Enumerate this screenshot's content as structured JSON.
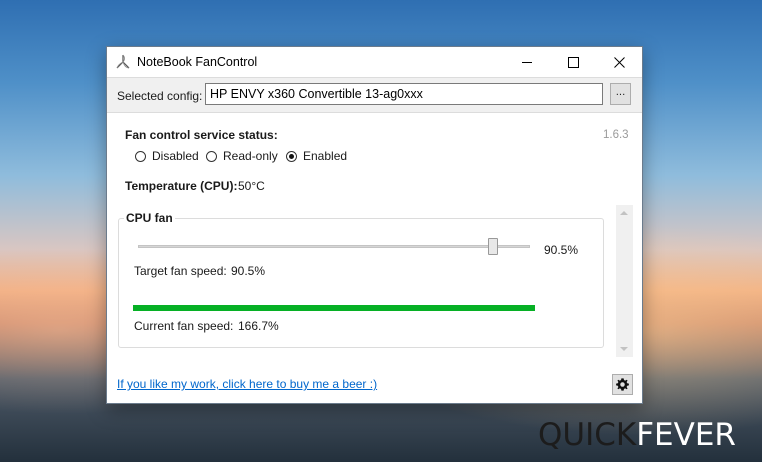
{
  "window": {
    "title": "NoteBook FanControl",
    "icon": "fan-icon",
    "controls": [
      "minimize-icon",
      "maximize-icon",
      "close-icon"
    ]
  },
  "config": {
    "label": "Selected config:",
    "value": "HP ENVY x360 Convertible 13-ag0xxx",
    "browse_label": "..."
  },
  "version": "1.6.3",
  "service": {
    "label": "Fan control service status:",
    "options": [
      {
        "label": "Disabled",
        "checked": false
      },
      {
        "label": "Read-only",
        "checked": false
      },
      {
        "label": "Enabled",
        "checked": true
      }
    ]
  },
  "temperature": {
    "label": "Temperature (CPU):",
    "value": "50°C"
  },
  "fan": {
    "title": "CPU fan",
    "slider_value": "90.5%",
    "slider_fraction": 0.905,
    "target_label": "Target fan speed:",
    "target_value": "90.5%",
    "current_label": "Current fan speed:",
    "current_value": "166.7%",
    "current_fraction": 1.0,
    "bar_color": "#06b025"
  },
  "footer": {
    "link": "If you like my work, click here to buy me a beer :)",
    "settings_icon": "gear-icon"
  },
  "watermark": {
    "part1": "QUICK",
    "part2": "FEVER"
  }
}
